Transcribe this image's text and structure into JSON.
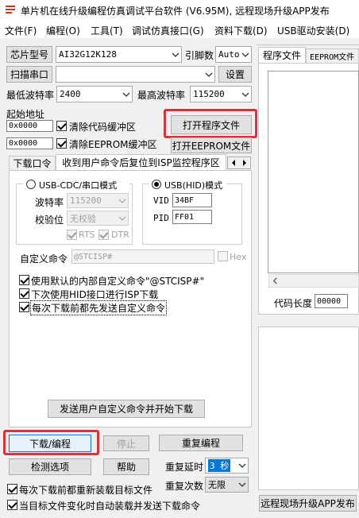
{
  "window": {
    "title": "单片机在线升级编程仿真调试平台软件 (V6.95M), 远程现场升级APP发布"
  },
  "menu": [
    "文件(F)",
    "编程(O)",
    "工具(T)",
    "调试仿真接口(G)",
    "资料下载(D)",
    "USB驱动安装(D)"
  ],
  "chip": {
    "label": "芯片型号",
    "value": "AI32G12K128",
    "pins_label": "引脚数",
    "pins_value": "Auto"
  },
  "port": {
    "scan_label": "扫描串口",
    "value": "",
    "settings_label": "设置"
  },
  "baud": {
    "min_label": "最低波特率",
    "min_value": "2400",
    "max_label": "最高波特率",
    "max_value": "115200"
  },
  "start_addr": {
    "label": "起始地址",
    "code_addr": "0x0000",
    "eeprom_addr": "0x0000",
    "clear_code": "清除代码缓冲区",
    "clear_eeprom": "清除EEPROM缓冲区"
  },
  "open_program": "打开程序文件",
  "open_eeprom": "打开EEPROM文件",
  "tabs": [
    "下载口令",
    "收到用户命令后复位到ISP监控程序区"
  ],
  "usb_cdc": {
    "label": "USB-CDC/串口模式",
    "baud_label": "波特率",
    "baud_value": "115200",
    "parity_label": "校验位",
    "parity_value": "无校验",
    "rts": "RTS",
    "dtr": "DTR"
  },
  "usb_hid": {
    "label": "USB(HID)模式",
    "vid_label": "VID",
    "vid_value": "34BF",
    "pid_label": "PID",
    "pid_value": "FF01"
  },
  "custom_cmd": {
    "label": "自定义命令",
    "value": "@STCISP#",
    "hex": "Hex"
  },
  "options": [
    "使用默认的内部自定义命令\"@STCISP#\"",
    "下次使用HID接口进行ISP下载",
    "每次下载前都先发送自定义命令"
  ],
  "send_custom": "发送用户自定义命令并开始下载",
  "download": "下载/编程",
  "stop": "停止",
  "reprogram": "重复编程",
  "check_opts": "检测选项",
  "help": "帮助",
  "repeat_delay": {
    "label": "重复延时",
    "value": "3 秒"
  },
  "repeat_count": {
    "label": "重复次数",
    "value": "无限"
  },
  "reload_each": "每次下载前都重新装载目标文件",
  "auto_reload": "当目标文件变化时自动装载并发送下载命令",
  "right_tabs": [
    "程序文件",
    "EEPROM文件"
  ],
  "code_len": {
    "label": "代码长度",
    "value": "00000"
  },
  "remote_upgrade": "远程现场升级APP发布",
  "colors": {
    "highlight": "#e0303a",
    "selection": "#0078d7"
  }
}
